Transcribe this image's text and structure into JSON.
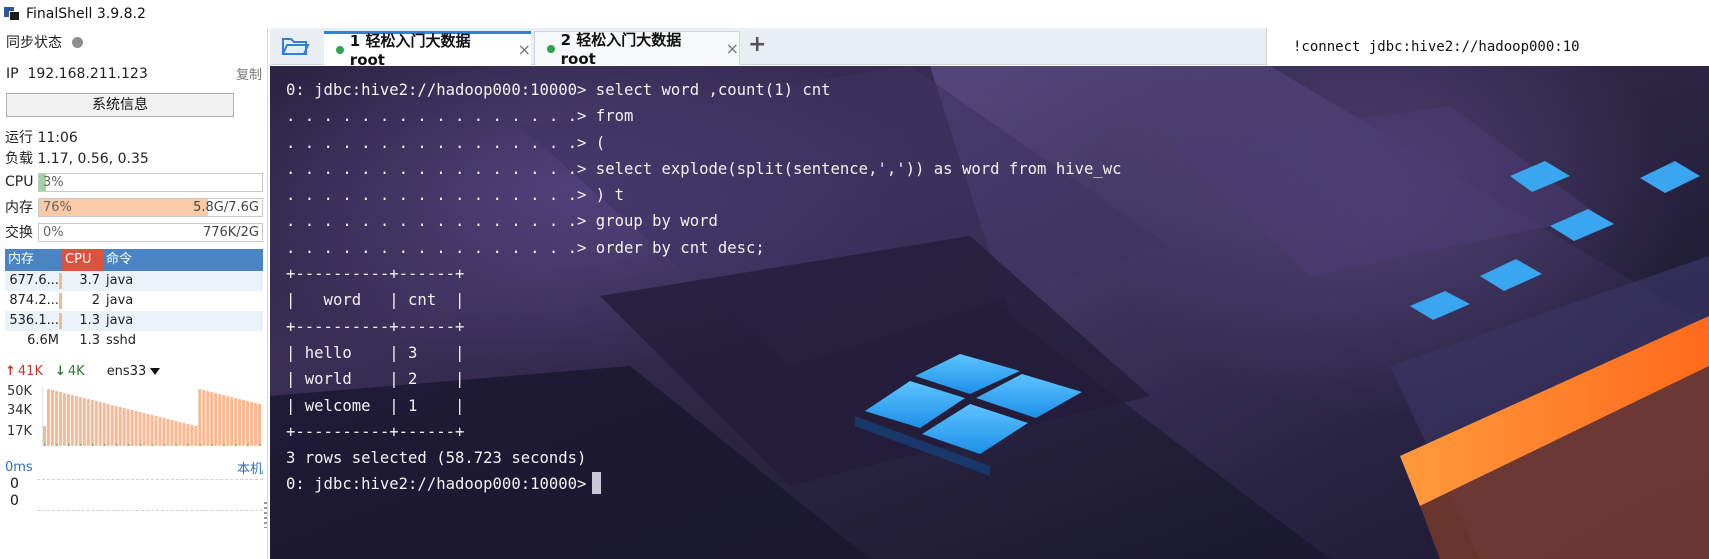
{
  "app": {
    "title": "FinalShell 3.9.8.2"
  },
  "sidebar": {
    "sync_label": "同步状态",
    "ip_label": "IP",
    "ip": "192.168.211.123",
    "copy_label": "复制",
    "sysinfo_button": "系统信息",
    "uptime": "运行 11:06",
    "load": "负载 1.17, 0.56, 0.35",
    "meters": {
      "cpu": {
        "label": "CPU",
        "percent_text": "3%",
        "value": 0.03,
        "detail": "",
        "color": "#9fd3a0"
      },
      "mem": {
        "label": "内存",
        "percent_text": "76%",
        "value": 0.76,
        "detail": "5.8G/7.6G",
        "color": "#fbcaa6"
      },
      "swap": {
        "label": "交换",
        "percent_text": "0%",
        "value": 0.0,
        "detail": "776K/2G",
        "color": "#9fd3a0"
      }
    },
    "process_table": {
      "headers": {
        "mem": "内存",
        "cpu": "CPU",
        "cmd": "命令"
      },
      "rows": [
        {
          "mem": "677.6...",
          "cpu": "3.7",
          "cmd": "java"
        },
        {
          "mem": "874.2...",
          "cpu": "2",
          "cmd": "java"
        },
        {
          "mem": "536.1...",
          "cpu": "1.3",
          "cmd": "java"
        },
        {
          "mem": "6.6M",
          "cpu": "1.3",
          "cmd": "sshd"
        }
      ]
    },
    "network": {
      "up_arrow": "↑",
      "up": "41K",
      "down_arrow": "↓",
      "down": "4K",
      "interface": "ens33",
      "axis_labels": [
        "50K",
        "34K",
        "17K"
      ]
    },
    "ping": {
      "latency": "0ms",
      "target": "本机",
      "values": [
        "0",
        "0"
      ]
    }
  },
  "tabs": {
    "items": [
      {
        "label": "1 轻松入门大数据root",
        "active": true
      },
      {
        "label": "2 轻松入门大数据root",
        "active": false
      }
    ],
    "close_glyph": "×",
    "add_glyph": "+"
  },
  "command_input": {
    "value": "!connect jdbc:hive2://hadoop000:10"
  },
  "terminal": {
    "lines": [
      "0: jdbc:hive2://hadoop000:10000> select word ,count(1) cnt",
      ". . . . . . . . . . . . . . . .> from",
      ". . . . . . . . . . . . . . . .> (",
      ". . . . . . . . . . . . . . . .> select explode(split(sentence,',')) as word from hive_wc",
      ". . . . . . . . . . . . . . . .> ) t",
      ". . . . . . . . . . . . . . . .> group by word",
      ". . . . . . . . . . . . . . . .> order by cnt desc;",
      "+----------+------+",
      "|   word   | cnt  |",
      "+----------+------+",
      "| hello    | 3    |",
      "| world    | 2    |",
      "| welcome  | 1    |",
      "+----------+------+",
      "3 rows selected (58.723 seconds)",
      "0: jdbc:hive2://hadoop000:10000>"
    ]
  }
}
